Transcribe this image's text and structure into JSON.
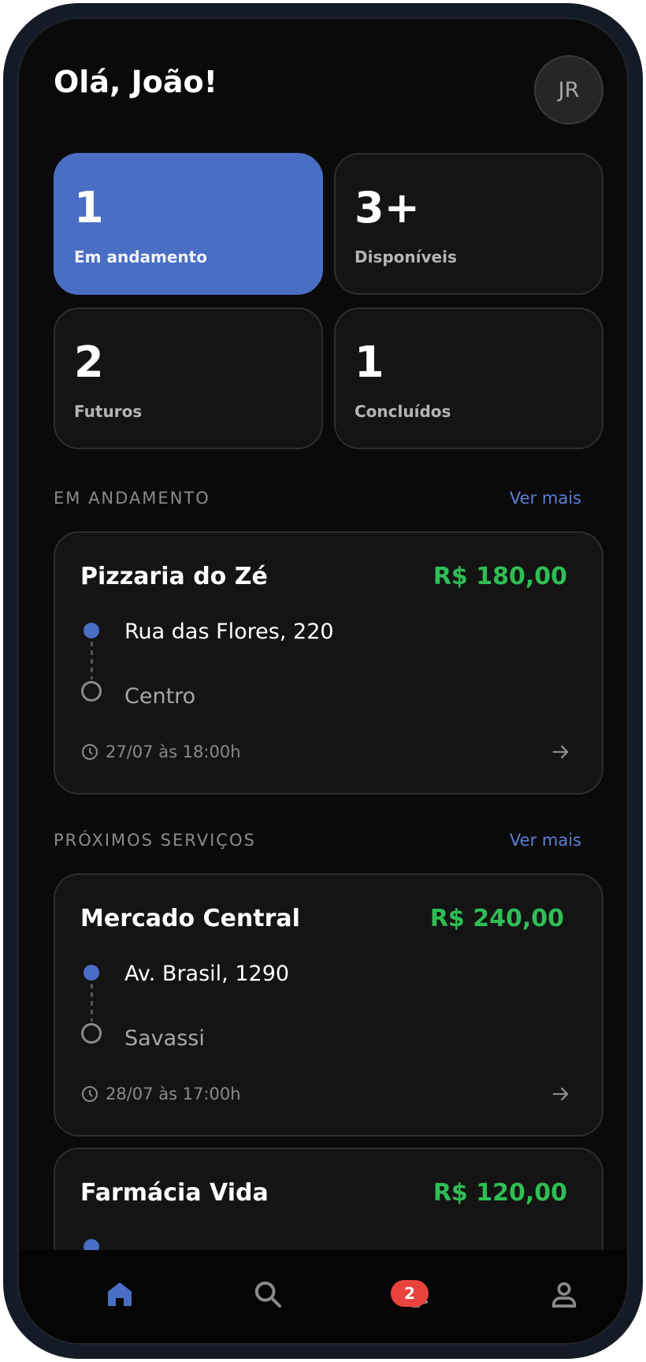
{
  "header": {
    "greeting": "Olá, João!",
    "avatar_initials": "JR"
  },
  "stats": [
    {
      "value": "1",
      "label": "Em andamento",
      "active": true
    },
    {
      "value": "3+",
      "label": "Disponíveis",
      "active": false
    },
    {
      "value": "2",
      "label": "Futuros",
      "active": false
    },
    {
      "value": "1",
      "label": "Concluídos",
      "active": false
    }
  ],
  "in_progress": {
    "section_title": "EM ANDAMENTO",
    "see_more": "Ver mais",
    "jobs": [
      {
        "title": "Pizzaria do Zé",
        "price": "R$ 180,00",
        "from": "Rua das Flores, 220",
        "to": "Centro",
        "time": "27/07 às 18:00h"
      }
    ]
  },
  "upcoming": {
    "section_title": "PRÓXIMOS SERVIÇOS",
    "see_more": "Ver mais",
    "jobs": [
      {
        "title": "Mercado Central",
        "price": "R$ 240,00",
        "from": "Av. Brasil, 1290",
        "to": "Savassi",
        "time": "28/07 às 17:00h"
      },
      {
        "title": "Farmácia Vida",
        "price": "R$ 120,00"
      }
    ]
  },
  "nav": {
    "items": [
      {
        "icon": "home-icon",
        "active": true
      },
      {
        "icon": "search-icon",
        "active": false
      },
      {
        "icon": "bell-icon",
        "active": false,
        "badge": "2"
      },
      {
        "icon": "user-icon",
        "active": false
      }
    ]
  },
  "colors": {
    "accent": "#4a6ec4",
    "price": "#2fbe55",
    "link": "#5b7fd6",
    "badge": "#e8433c",
    "background": "#0a0a0b",
    "card": "#141414"
  }
}
